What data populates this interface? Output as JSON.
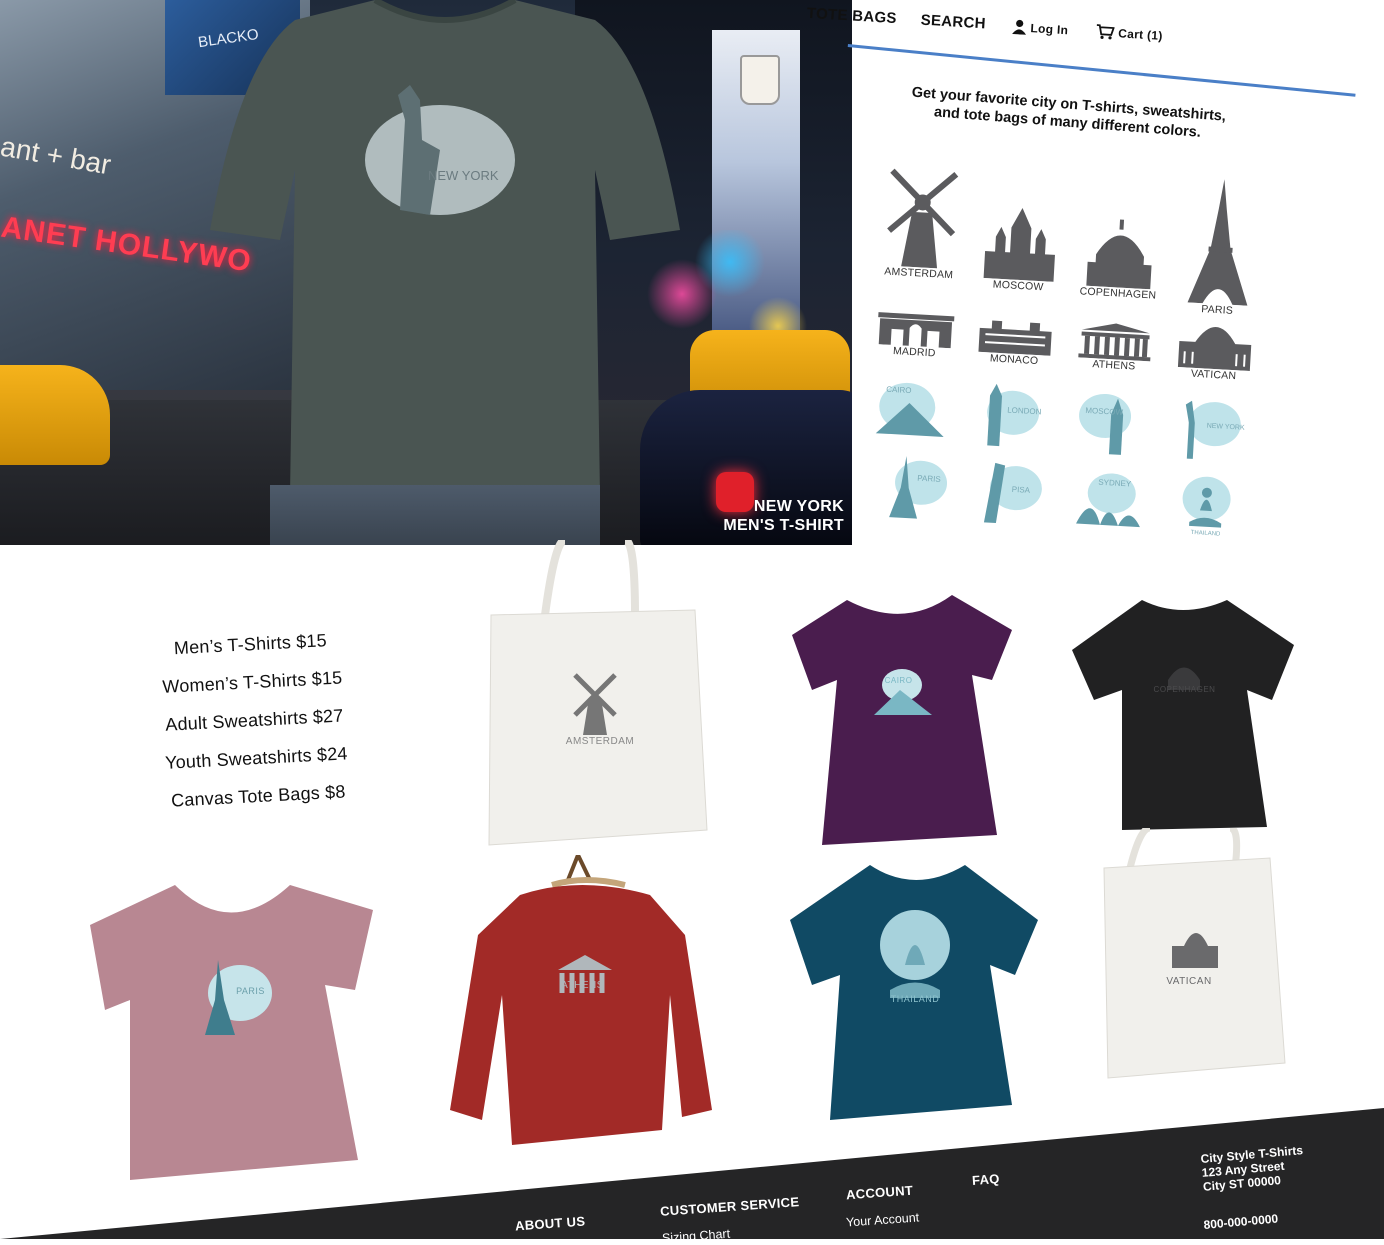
{
  "nav": {
    "tote_bags": "TOTE BAGS",
    "search": "SEARCH",
    "login": "Log In",
    "cart": "Cart (1)"
  },
  "hero": {
    "billboard_text": "BLACKO",
    "neon_sign": "ANET HOLLYWO",
    "bar_sign": "ant + bar",
    "shirt_print": "NEW YORK",
    "caption_line1": "NEW YORK",
    "caption_line2": "MEN'S T-SHIRT"
  },
  "tagline": {
    "line1": "Get your favorite city on T-shirts, sweatshirts,",
    "line2": "and tote bags of many different colors."
  },
  "cities_row1": [
    "AMSTERDAM",
    "MOSCOW",
    "COPENHAGEN",
    "PARIS"
  ],
  "cities_row2": [
    "MADRID",
    "MONACO",
    "ATHENS",
    "VATICAN"
  ],
  "sketches_row3": [
    "CAIRO",
    "LONDON",
    "MOSCOW",
    "NEW YORK"
  ],
  "sketches_row4": [
    "PARIS",
    "PISA",
    "SYDNEY",
    "THAILAND"
  ],
  "prices": [
    "Men’s T-Shirts $15",
    "Women’s T-Shirts $15",
    "Adult Sweatshirts $27",
    "Youth Sweatshirts $24",
    "Canvas Tote Bags $8"
  ],
  "products": {
    "tote_amsterdam": "AMSTERDAM",
    "purple_tee": "CAIRO",
    "black_tee": "COPENHAGEN",
    "pink_tee": "PARIS",
    "red_sweatshirt": "ATHENS",
    "blue_tee": "THAILAND",
    "tote_vatican": "VATICAN"
  },
  "footer": {
    "about": "ABOUT US",
    "customer_service": "CUSTOMER SERVICE",
    "sizing": "Sizing Chart",
    "account": "ACCOUNT",
    "your_account": "Your Account",
    "faq": "FAQ",
    "address_name": "City Style T-Shirts",
    "address_street": "123 Any Street",
    "address_city": "City ST 00000",
    "phone": "800-000-0000"
  },
  "colors": {
    "accent_rule": "#4a7fc7",
    "footer_bg": "#252526",
    "icon_gray": "#5b5b5e",
    "sketch_blue": "#bfe3ea"
  }
}
